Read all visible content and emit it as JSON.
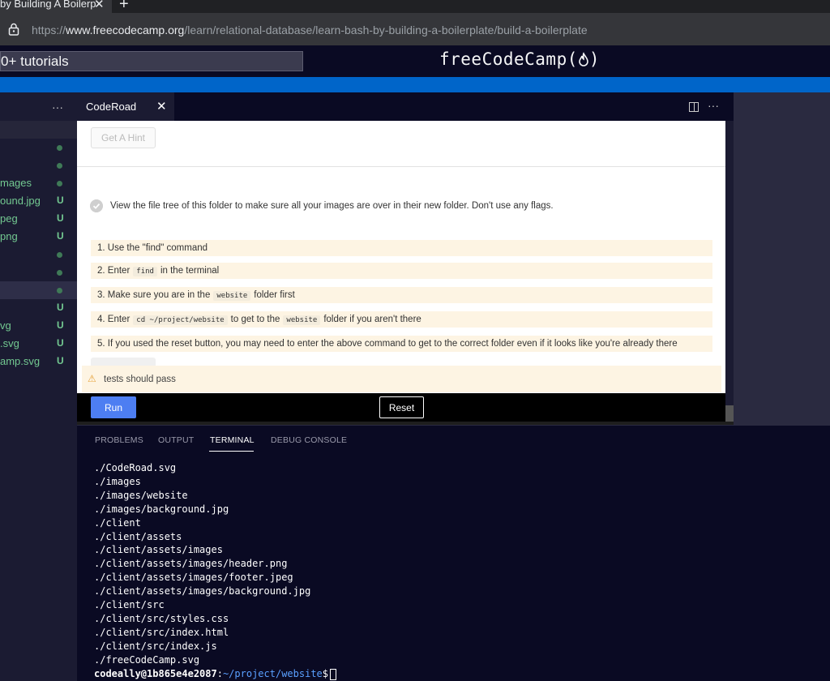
{
  "browser": {
    "tab_title": "by Building A Boilerp",
    "close_glyph": "✕",
    "new_tab_glyph": "+",
    "url_prefix": "https://",
    "url_domain": "www.freecodecamp.org",
    "url_path": "/learn/relational-database/learn-bash-by-building-a-boilerplate/build-a-boilerplate"
  },
  "fcc": {
    "search_text": "0+ tutorials",
    "logo_text": "freeCodeCamp(",
    "logo_close": ")"
  },
  "explorer": {
    "more_glyph": "···",
    "rows": [
      {
        "name": "",
        "marker": "dot"
      },
      {
        "name": "",
        "marker": "dot"
      },
      {
        "name": "mages",
        "marker": "dot"
      },
      {
        "name": "ound.jpg",
        "marker": "U"
      },
      {
        "name": "peg",
        "marker": "U"
      },
      {
        "name": "png",
        "marker": "U"
      },
      {
        "name": "",
        "marker": "dot"
      },
      {
        "name": "",
        "marker": "dot"
      },
      {
        "name": "",
        "marker": "dot"
      },
      {
        "name": "",
        "marker": "U"
      },
      {
        "name": "vg",
        "marker": "U"
      },
      {
        "name": ".svg",
        "marker": "U"
      },
      {
        "name": "amp.svg",
        "marker": "U"
      }
    ]
  },
  "editor": {
    "tab_label": "CodeRoad",
    "close_glyph": "✕",
    "more_glyph": "···"
  },
  "tutorial": {
    "hint_button": "Get A Hint",
    "task": "View the file tree of this folder to make sure all your images are over in their new folder. Don't use any flags.",
    "hints": [
      {
        "before": "1. Use the \"find\" command",
        "code": "",
        "after": ""
      },
      {
        "before": "2. Enter",
        "code": "find",
        "after": "in the terminal"
      },
      {
        "before": "3. Make sure you are in the",
        "code": "website",
        "after": "folder first"
      },
      {
        "before": "4. Enter",
        "code": "cd ~/project/website",
        "after": "to get to the",
        "code2": "website",
        "after2": "folder if you aren't there"
      },
      {
        "before": "5. If you used the reset button, you may need to enter the above command to get to the correct folder even if it looks like you're already there",
        "code": "",
        "after": ""
      }
    ],
    "warning_glyph": "⚠",
    "tests_text": "tests should pass",
    "run_label": "Run",
    "reset_label": "Reset"
  },
  "panel": {
    "tabs": [
      "PROBLEMS",
      "OUTPUT",
      "TERMINAL",
      "DEBUG CONSOLE"
    ],
    "active_tab": "TERMINAL"
  },
  "terminal": {
    "lines": [
      "./CodeRoad.svg",
      "./images",
      "./images/website",
      "./images/background.jpg",
      "./client",
      "./client/assets",
      "./client/assets/images",
      "./client/assets/images/header.png",
      "./client/assets/images/footer.jpeg",
      "./client/assets/images/background.jpg",
      "./client/src",
      "./client/src/styles.css",
      "./client/src/index.html",
      "./client/src/index.js",
      "./freeCodeCamp.svg"
    ],
    "prompt_user": "codeally@1b865e4e2087",
    "prompt_sep": ":",
    "prompt_path": "~/project/website",
    "prompt_symbol": "$"
  }
}
